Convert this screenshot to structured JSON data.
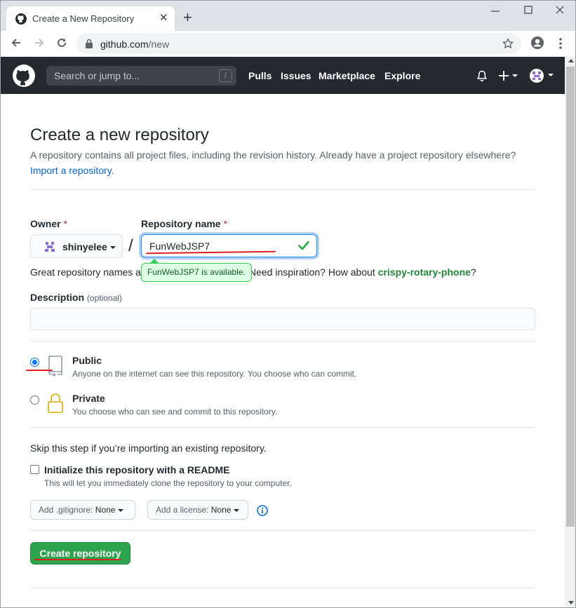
{
  "browser": {
    "tab_title": "Create a New Repository",
    "new_tab_symbol": "+",
    "close_symbol": "✕",
    "url_host": "github.com",
    "url_path": "/new"
  },
  "gh_header": {
    "search_placeholder": "Search or jump to...",
    "search_shortcut": "/",
    "nav": [
      "Pulls",
      "Issues",
      "Marketplace",
      "Explore"
    ]
  },
  "page": {
    "title": "Create a new repository",
    "subtitle": "A repository contains all project files, including the revision history. Already have a project repository elsewhere?",
    "import_link": "Import a repository."
  },
  "form": {
    "owner_label": "Owner",
    "required_mark": "*",
    "owner_value": "shinyelee",
    "slash": "/",
    "repo_label": "Repository name",
    "repo_value": "FunWebJSP7",
    "availability_tooltip": "FunWebJSP7 is available.",
    "great_names_text": "Great repository names ar",
    "inspiration_text": "Need inspiration? How about",
    "suggestion": "crispy-rotary-phone",
    "suggestion_suffix": "?",
    "description_label": "Description",
    "description_optional": "(optional)",
    "description_value": "",
    "visibility": {
      "selected": "Public",
      "public_title": "Public",
      "public_desc": "Anyone on the internet can see this repository. You choose who can commit.",
      "private_title": "Private",
      "private_desc": "You choose who can see and commit to this repository."
    },
    "skip_text": "Skip this step if you’re importing an existing repository.",
    "readme_title": "Initialize this repository with a README",
    "readme_desc": "This will let you immediately clone the repository to your computer.",
    "readme_checked": false,
    "gitignore_label": "Add .gitignore:",
    "gitignore_value": "None",
    "license_label": "Add a license:",
    "license_value": "None",
    "create_button": "Create repository"
  },
  "colors": {
    "header_bg": "#24292e",
    "link": "#0366d6",
    "primary_button": "#2ea44f",
    "success_text": "#22863a",
    "annotation_red": "#e02020"
  }
}
